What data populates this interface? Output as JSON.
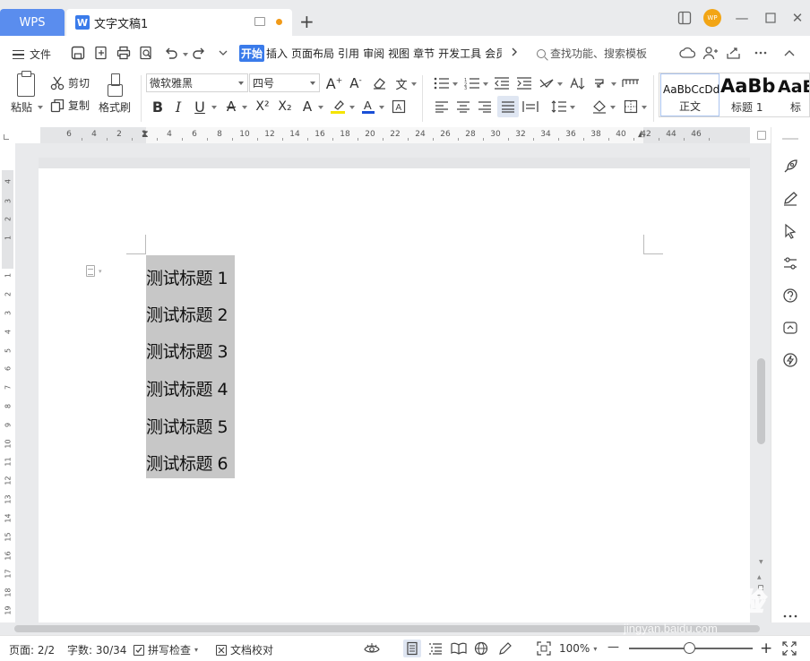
{
  "titlebar": {
    "app_tab": "WPS",
    "doc_tab": "文字文稿1",
    "doc_icon_letter": "W",
    "new_tab": "+",
    "avatar_text": "WP",
    "minimize": "—",
    "maximize": "☐",
    "close": "✕"
  },
  "menubar": {
    "file_label": "文件",
    "tabs": [
      "开始",
      "插入",
      "页面布局",
      "引用",
      "审阅",
      "视图",
      "章节",
      "开发工具",
      "会员"
    ],
    "search_placeholder": "查找功能、搜索模板"
  },
  "ribbon": {
    "paste": "粘贴",
    "cut": "剪切",
    "copy": "复制",
    "format_painter": "格式刷",
    "font_name": "微软雅黑",
    "font_size": "四号",
    "bold": "B",
    "italic": "I",
    "underline": "U",
    "strikethrough": "A",
    "superscript": "X²",
    "subscript": "X₂",
    "text_effect": "A",
    "font_color": "A",
    "highlight_color": "#f5e400",
    "font_color_value": "#1a4fd6",
    "styles": [
      {
        "sample": "AaBbCcDd",
        "name": "正文"
      },
      {
        "sample": "AaBb",
        "name": "标题 1"
      },
      {
        "sample": "AaE",
        "name": "标"
      }
    ]
  },
  "ruler": {
    "h_numbers": [
      "6",
      "4",
      "2",
      "2",
      "4",
      "6",
      "8",
      "10",
      "12",
      "14",
      "16",
      "18",
      "20",
      "22",
      "24",
      "26",
      "28",
      "30",
      "32",
      "34",
      "36",
      "38",
      "40",
      "42",
      "44",
      "46"
    ],
    "v_numbers": [
      "4",
      "3",
      "2",
      "1",
      "1",
      "2",
      "3",
      "4",
      "5",
      "6",
      "7",
      "8",
      "9",
      "10",
      "11",
      "12",
      "13",
      "14",
      "15",
      "16",
      "17",
      "18",
      "19"
    ]
  },
  "document": {
    "headings": [
      "测试标题 1",
      "测试标题 2",
      "测试标题 3",
      "测试标题 4",
      "测试标题 5",
      "测试标题 6"
    ]
  },
  "statusbar": {
    "page": "页面: 2/2",
    "word_count": "字数: 30/34",
    "spell_check": "拼写检查",
    "doc_proof": "文档校对",
    "zoom": "100%",
    "zoom_out": "—",
    "zoom_in": "+",
    "zoom_level": 0.5
  },
  "watermark": {
    "brand": "Baidu经验",
    "url": "jingyan.baidu.com"
  }
}
